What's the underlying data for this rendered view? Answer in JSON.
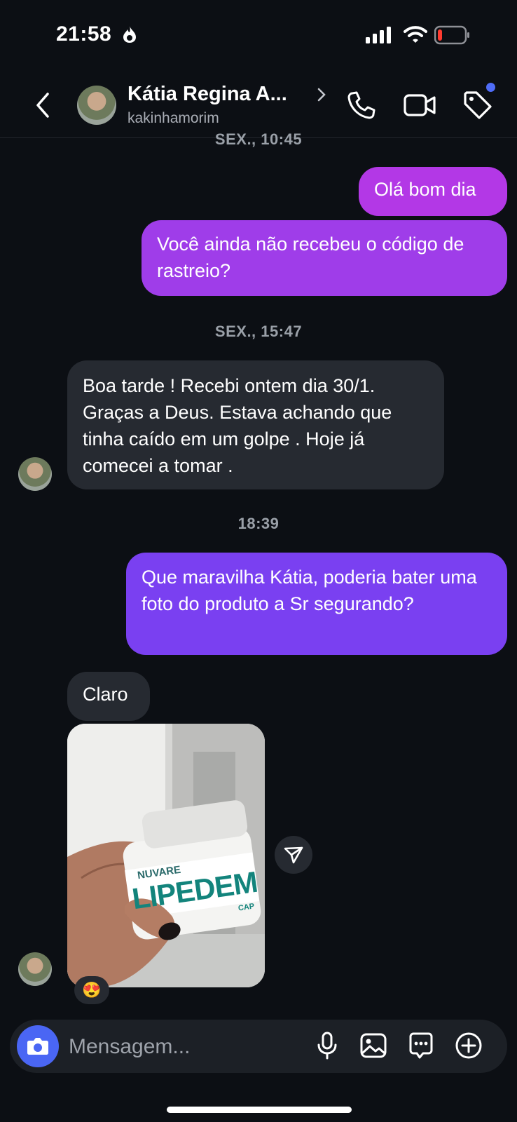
{
  "status_bar": {
    "time": "21:58",
    "battery_color": "#ff3b30"
  },
  "header": {
    "contact_name": "Kátia Regina A...",
    "contact_handle": "kakinhamorim",
    "icons": [
      "chevron-left-icon",
      "phone-icon",
      "video-camera-icon",
      "tag-icon"
    ]
  },
  "conversation": {
    "time_labels": [
      "SEX., 10:45",
      "SEX., 15:47",
      "18:39"
    ],
    "messages": [
      {
        "sender": "me",
        "text": "Olá bom dia"
      },
      {
        "sender": "me",
        "text": "Você ainda não recebeu o código de rastreio?"
      },
      {
        "sender": "contact",
        "text": "Boa tarde ! Recebi ontem dia 30/1. Graças a Deus. Estava achando que tinha caído em um golpe . Hoje já comecei a tomar ."
      },
      {
        "sender": "me",
        "text": "Que maravilha Kátia, poderia bater uma foto do produto a Sr segurando?"
      },
      {
        "sender": "contact",
        "text": "Claro"
      },
      {
        "sender": "contact",
        "type": "photo",
        "product_brand": "NUVARE",
        "product_name": "LIPEDEM",
        "product_sub": "CAP",
        "reaction": "😍"
      }
    ]
  },
  "composer": {
    "placeholder": "Mensagem...",
    "accent": "#4a66f4"
  },
  "colors": {
    "outgoing_top": "#b338e6",
    "outgoing_bottom": "#6e42f5",
    "incoming": "#262a31",
    "background": "#0c0f14"
  }
}
